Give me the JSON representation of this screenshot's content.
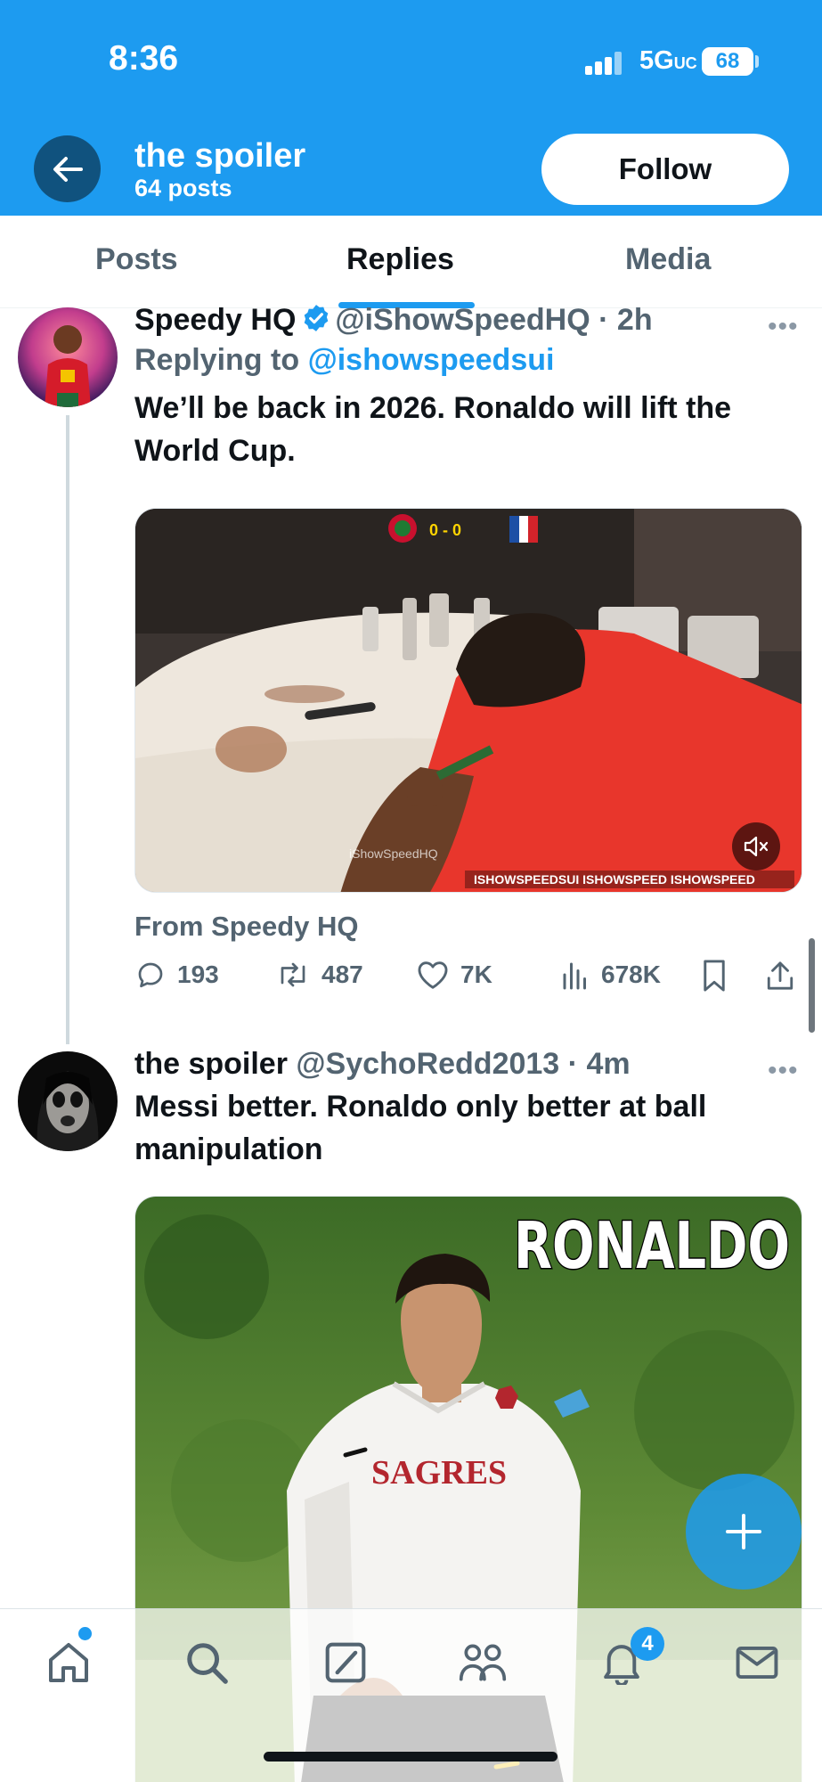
{
  "status_bar": {
    "time": "8:36",
    "network": "5G",
    "network_suffix": "UC",
    "battery": "68"
  },
  "header": {
    "title": "the spoiler",
    "subtitle": "64 posts",
    "follow_label": "Follow"
  },
  "tabs": [
    {
      "label": "Posts",
      "active": false
    },
    {
      "label": "Replies",
      "active": true
    },
    {
      "label": "Media",
      "active": false
    }
  ],
  "tweets": [
    {
      "name": "Speedy HQ",
      "verified": true,
      "handle": "@iShowSpeedHQ",
      "time": "2h",
      "replying_to_label": "Replying to",
      "replying_to": "@ishowspeedsui",
      "text": "We’ll be back in 2026. Ronaldo will lift the World Cup.",
      "media": {
        "type": "video",
        "score": "0 - 0",
        "watermark": "iShowSpeedHQ",
        "socials": "ISHOWSPEEDSUI  ISHOWSPEED  ISHOWSPEED",
        "muted_icon": "muted-speaker-icon"
      },
      "from_label": "From Speedy HQ",
      "stats": {
        "replies": "193",
        "reposts": "487",
        "likes": "7K",
        "views": "678K"
      }
    },
    {
      "name": "the spoiler",
      "verified": false,
      "handle": "@SychoRedd2013",
      "time": "4m",
      "text": "Messi better. Ronaldo only better at ball manipulation",
      "media": {
        "type": "image",
        "caption": "RONALDO",
        "shirt_text": "SAGRES"
      }
    }
  ],
  "bottom_nav": {
    "items": [
      "home-icon",
      "search-icon",
      "grok-icon",
      "communities-icon",
      "notifications-icon",
      "messages-icon"
    ],
    "notifications_badge": "4"
  },
  "colors": {
    "accent": "#1d9bf0",
    "text": "#0f1419",
    "secondary": "#536471"
  }
}
